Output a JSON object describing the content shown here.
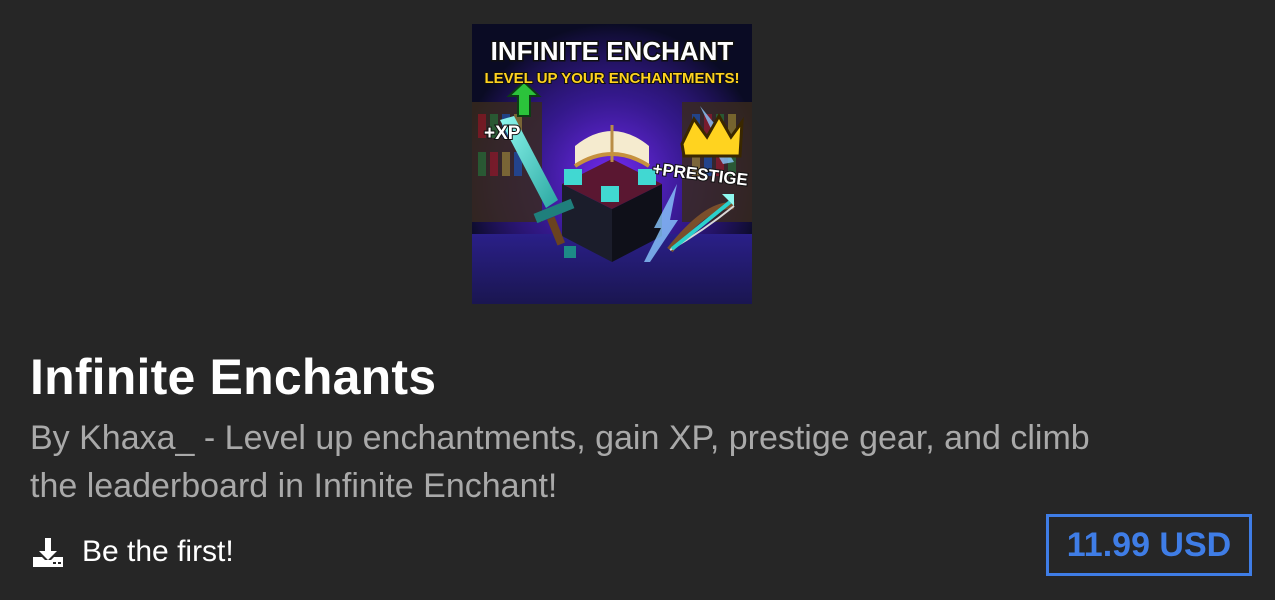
{
  "thumbnail": {
    "headline": "INFINITE ENCHANT",
    "subheadline": "LEVEL UP YOUR ENCHANTMENTS!",
    "xp_label": "+XP",
    "prestige_label": "+PRESTIGE"
  },
  "product": {
    "title": "Infinite Enchants",
    "description": "By Khaxa_ - Level up enchantments, gain XP, prestige gear, and climb the leaderboard in Infinite Enchant!",
    "downloads_label": "Be the first!",
    "price": "11.99 USD"
  },
  "colors": {
    "background": "#262626",
    "title": "#ffffff",
    "description": "#a9a9a9",
    "accent": "#3f7de6"
  },
  "icons": {
    "downloads": "download-icon"
  }
}
